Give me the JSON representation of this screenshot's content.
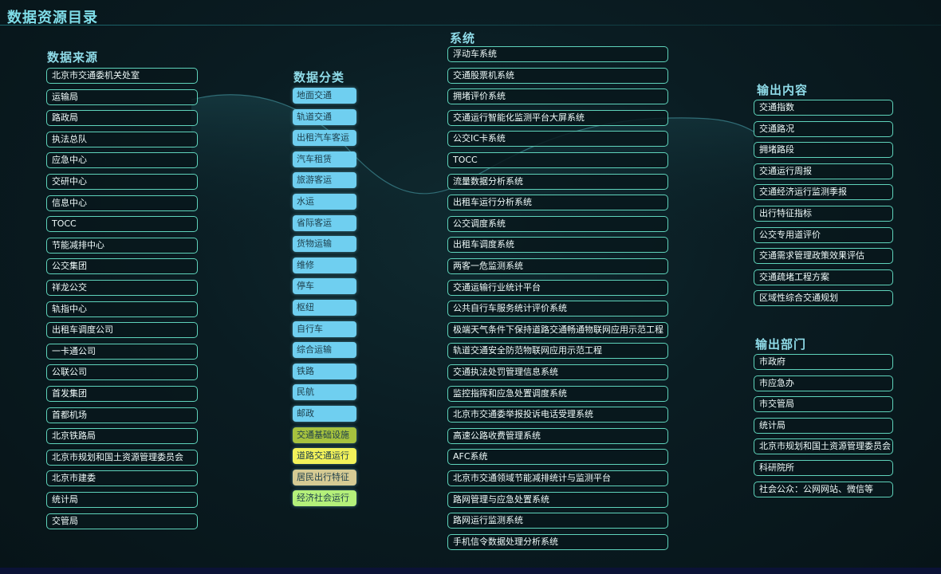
{
  "title": "数据资源目录",
  "sources": {
    "title": "数据来源",
    "items": [
      "北京市交通委机关处室",
      "运输局",
      "路政局",
      "执法总队",
      "应急中心",
      "交研中心",
      "信息中心",
      "TOCC",
      "节能减排中心",
      "公交集团",
      "祥龙公交",
      "轨指中心",
      "出租车调度公司",
      "一卡通公司",
      "公联公司",
      "首发集团",
      "首都机场",
      "北京铁路局",
      "北京市规划和国土资源管理委员会",
      "北京市建委",
      "统计局",
      "交管局"
    ]
  },
  "categories": {
    "title": "数据分类",
    "items": [
      {
        "label": "地面交通",
        "color": "#6fcff0"
      },
      {
        "label": "轨道交通",
        "color": "#6fcff0"
      },
      {
        "label": "出租汽车客运",
        "color": "#6fcff0"
      },
      {
        "label": "汽车租赁",
        "color": "#6fcff0"
      },
      {
        "label": "旅游客运",
        "color": "#6fcff0"
      },
      {
        "label": "水运",
        "color": "#6fcff0"
      },
      {
        "label": "省际客运",
        "color": "#6fcff0"
      },
      {
        "label": "货物运输",
        "color": "#6fcff0"
      },
      {
        "label": "维修",
        "color": "#6fcff0"
      },
      {
        "label": "停车",
        "color": "#6fcff0"
      },
      {
        "label": "枢纽",
        "color": "#6fcff0"
      },
      {
        "label": "自行车",
        "color": "#6fcff0"
      },
      {
        "label": "综合运输",
        "color": "#6fcff0"
      },
      {
        "label": "铁路",
        "color": "#6fcff0"
      },
      {
        "label": "民航",
        "color": "#6fcff0"
      },
      {
        "label": "邮政",
        "color": "#6fcff0"
      },
      {
        "label": "交通基础设施",
        "color": "#a6c23e"
      },
      {
        "label": "道路交通运行",
        "color": "#f2f25a"
      },
      {
        "label": "居民出行特征",
        "color": "#d6cb94"
      },
      {
        "label": "经济社会运行",
        "color": "#b4f07a"
      }
    ]
  },
  "systems": {
    "title": "系统",
    "items": [
      "浮动车系统",
      "交通股票机系统",
      "拥堵评价系统",
      "交通运行智能化监测平台大屏系统",
      "公交IC卡系统",
      "TOCC",
      "流量数据分析系统",
      "出租车运行分析系统",
      "公交调度系统",
      "出租车调度系统",
      "两客一危监测系统",
      "交通运输行业统计平台",
      "公共自行车服务统计评价系统",
      "极端天气条件下保持道路交通畅通物联网应用示范工程",
      "轨道交通安全防范物联网应用示范工程",
      "交通执法处罚管理信息系统",
      "监控指挥和应急处置调度系统",
      "北京市交通委举报投诉电话受理系统",
      "高速公路收费管理系统",
      "AFC系统",
      "北京市交通领域节能减排统计与监测平台",
      "路网管理与应急处置系统",
      "路网运行监测系统",
      "手机信令数据处理分析系统"
    ]
  },
  "outputs": {
    "title": "输出内容",
    "items": [
      "交通指数",
      "交通路况",
      "拥堵路段",
      "交通运行周报",
      "交通经济运行监测季报",
      "出行特征指标",
      "公交专用道评价",
      "交通需求管理政策效果评估",
      "交通疏堵工程方案",
      "区域性综合交通规划"
    ]
  },
  "departments": {
    "title": "输出部门",
    "items": [
      "市政府",
      "市应急办",
      "市交管局",
      "统计局",
      "北京市规划和国土资源管理委员会",
      "科研院所",
      "社会公众：公网网站、微信等"
    ]
  }
}
